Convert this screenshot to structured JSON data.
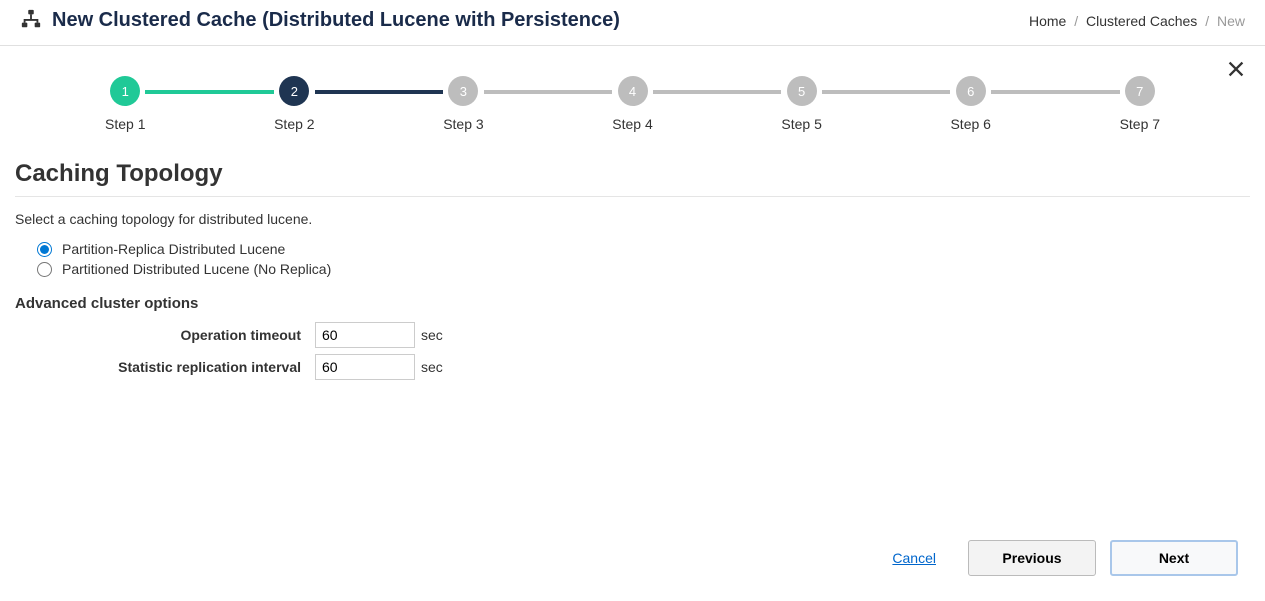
{
  "header": {
    "title": "New Clustered Cache (Distributed Lucene with Persistence)"
  },
  "breadcrumb": {
    "home": "Home",
    "mid": "Clustered Caches",
    "current": "New"
  },
  "stepper": {
    "steps": [
      {
        "num": "1",
        "label": "Step 1",
        "state": "done"
      },
      {
        "num": "2",
        "label": "Step 2",
        "state": "active"
      },
      {
        "num": "3",
        "label": "Step 3",
        "state": "pending"
      },
      {
        "num": "4",
        "label": "Step 4",
        "state": "pending"
      },
      {
        "num": "5",
        "label": "Step 5",
        "state": "pending"
      },
      {
        "num": "6",
        "label": "Step 6",
        "state": "pending"
      },
      {
        "num": "7",
        "label": "Step 7",
        "state": "pending"
      }
    ]
  },
  "section": {
    "title": "Caching Topology",
    "description": "Select a caching topology for distributed lucene."
  },
  "topology": {
    "opt1": "Partition-Replica Distributed Lucene",
    "opt2": "Partitioned Distributed Lucene (No Replica)"
  },
  "advanced": {
    "title": "Advanced cluster options",
    "op_timeout_label": "Operation timeout",
    "op_timeout_value": "60",
    "op_timeout_unit": "sec",
    "stat_interval_label": "Statistic replication interval",
    "stat_interval_value": "60",
    "stat_interval_unit": "sec"
  },
  "footer": {
    "cancel": "Cancel",
    "previous": "Previous",
    "next": "Next"
  }
}
